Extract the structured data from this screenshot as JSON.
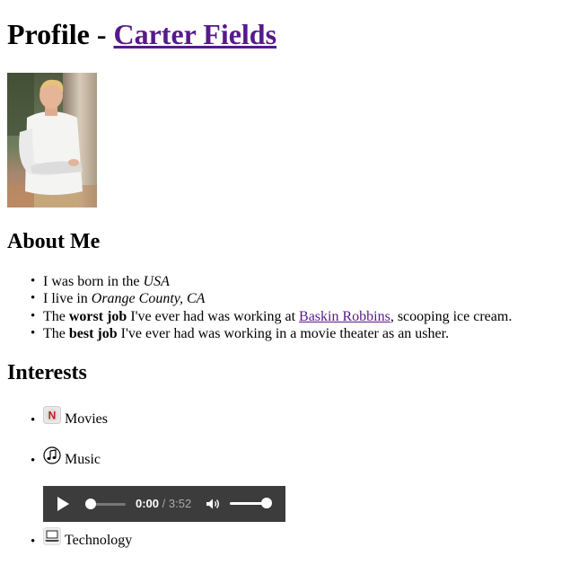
{
  "header": {
    "prefix": "Profile - ",
    "name_link": "Carter Fields"
  },
  "photo": {
    "alt": "Photo of Carter Fields"
  },
  "about": {
    "heading": "About Me",
    "items": [
      {
        "pre": "I was born in the ",
        "em": "USA"
      },
      {
        "pre": "I live in ",
        "em": "Orange County, CA"
      },
      {
        "pre": "The ",
        "strong": "worst job",
        "mid": " I've ever had was working at ",
        "link": "Baskin Robbins",
        "post": ", scooping ice cream."
      },
      {
        "pre": "The ",
        "strong": "best job",
        "post": " I've ever had was working in a movie theater as an usher."
      }
    ]
  },
  "interests": {
    "heading": "Interests",
    "items": [
      {
        "label": "Movies",
        "icon": "netflix-icon"
      },
      {
        "label": "Music",
        "icon": "music-note-icon"
      },
      {
        "label": "Technology",
        "icon": "laptop-icon"
      }
    ]
  },
  "audio_player": {
    "current_time": "0:00",
    "separator": " / ",
    "duration": "3:52",
    "progress_fraction": 0,
    "volume_fraction": 1
  },
  "colors": {
    "link_visited": "#551a8b",
    "player_bg": "#3c3c3c"
  }
}
